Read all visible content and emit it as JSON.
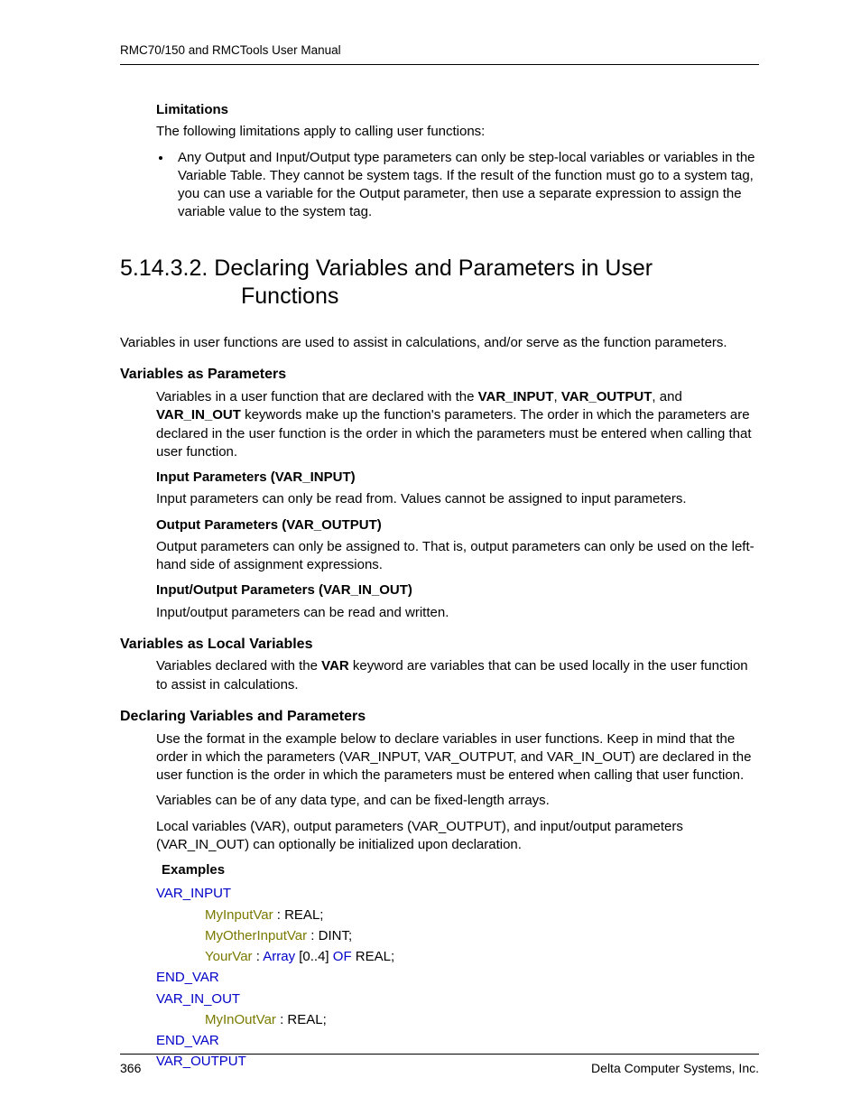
{
  "header": "RMC70/150 and RMCTools User Manual",
  "limitations": {
    "title": "Limitations",
    "intro": "The following limitations apply to calling user functions:",
    "bullet": "Any Output and Input/Output type parameters can only be step-local variables or variables in the Variable Table. They cannot be system tags. If the result of the function must go to a system tag, you can use a variable for the Output parameter, then use a separate expression to assign the variable value to the system tag."
  },
  "section": {
    "number": "5.14.3.2.",
    "title_line1": "Declaring Variables and Parameters in User",
    "title_line2": "Functions",
    "intro": "Variables in user functions are used to assist in calculations, and/or serve as the function parameters."
  },
  "vap": {
    "heading": "Variables as Parameters",
    "p1a": "Variables in a user function that are declared with the ",
    "kw1": "VAR_INPUT",
    "sep1": ", ",
    "kw2": "VAR_OUTPUT",
    "sep2": ", and ",
    "kw3": "VAR_IN_OUT",
    "p1b": " keywords make up the function's parameters. The order in which the parameters are declared in the user function is the order in which the parameters must be entered when calling that user function.",
    "input_h": "Input Parameters (VAR_INPUT)",
    "input_p": "Input parameters can only be read from. Values cannot be assigned to input parameters.",
    "output_h": "Output Parameters (VAR_OUTPUT)",
    "output_p": "Output parameters can only be assigned to. That is, output parameters can only be used on the left-hand side of assignment expressions.",
    "inout_h": "Input/Output Parameters (VAR_IN_OUT)",
    "inout_p": "Input/output parameters can be read and written."
  },
  "vlv": {
    "heading": "Variables as Local Variables",
    "p1a": "Variables declared with the ",
    "kw": "VAR",
    "p1b": " keyword are variables that can be used locally in the user function to assist in calculations."
  },
  "dvp": {
    "heading": "Declaring Variables and Parameters",
    "p1": "Use the format in the example below to declare variables in user functions. Keep in mind that the order in which the parameters (VAR_INPUT, VAR_OUTPUT, and VAR_IN_OUT) are declared in the user function is the order in which the parameters must be entered when calling that user function.",
    "p2": "Variables can be of any data type, and can be fixed-length arrays.",
    "p3": "Local variables (VAR), output parameters (VAR_OUTPUT), and input/output parameters (VAR_IN_OUT) can optionally be initialized upon declaration.",
    "examples": "Examples"
  },
  "code": {
    "var_input": "VAR_INPUT",
    "myinput": "MyInputVar",
    "myinput_t": " : REAL;",
    "myother": "MyOtherInputVar",
    "myother_t": " : DINT;",
    "yourvar": "YourVar",
    "yourvar_mid": " : ",
    "array_kw": "Array",
    "yourvar_range": " [0..4] ",
    "of_kw": "OF",
    "yourvar_tail": " REAL;",
    "end_var": "END_VAR",
    "var_in_out": "VAR_IN_OUT",
    "myinout": "MyInOutVar",
    "myinout_t": " : REAL;",
    "var_output": "VAR_OUTPUT"
  },
  "footer": {
    "page": "366",
    "org": "Delta Computer Systems, Inc."
  }
}
